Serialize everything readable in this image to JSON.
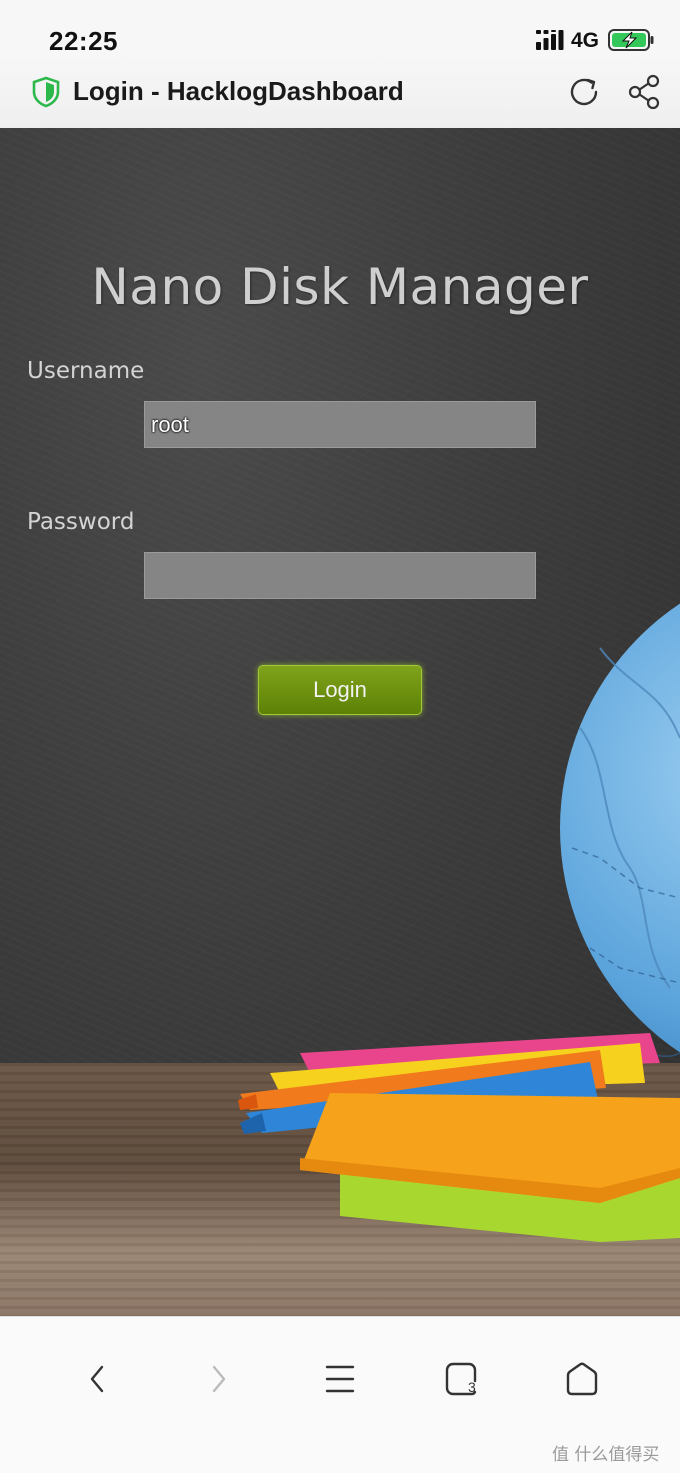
{
  "status_bar": {
    "time": "22:25",
    "network": "4G",
    "battery_color": "#34c759",
    "icons": [
      "signal-icon",
      "battery-charging-icon"
    ]
  },
  "browser": {
    "page_title": "Login - HacklogDashboard",
    "security_color": "#2db84b",
    "icons": [
      "shield-icon",
      "reload-icon",
      "share-icon"
    ]
  },
  "login": {
    "heading": "Nano Disk Manager",
    "username_label": "Username",
    "username_value": "root",
    "password_label": "Password",
    "password_value": "",
    "submit_label": "Login",
    "button_color": "#6b8f10"
  },
  "toolbar": {
    "tab_count": "3",
    "icons": [
      "back-icon",
      "forward-icon",
      "menu-icon",
      "tabs-icon",
      "home-icon"
    ]
  },
  "watermark": {
    "text": "值 什么值得买"
  }
}
